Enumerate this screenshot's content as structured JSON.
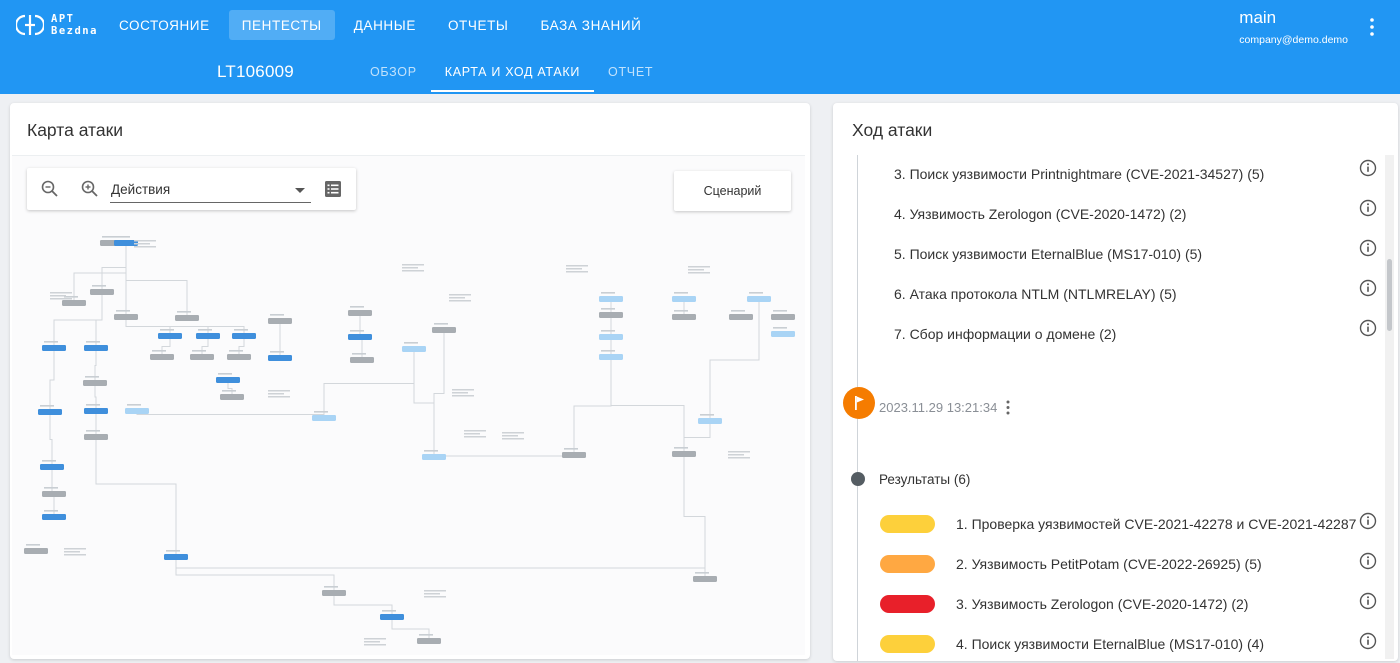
{
  "app": {
    "logo_lines": [
      "APT",
      "Bezdna"
    ],
    "nav": [
      "СОСТОЯНИЕ",
      "ПЕНТЕСТЫ",
      "ДАННЫЕ",
      "ОТЧЕТЫ",
      "БАЗА ЗНАНИЙ"
    ],
    "active_nav": "ПЕНТЕСТЫ",
    "user_name": "main",
    "user_email": "company@demo.demo"
  },
  "pentest": {
    "id": "LT106009",
    "tabs": [
      "ОБЗОР",
      "КАРТА И ХОД АТАКИ",
      "ОТЧЕТ"
    ],
    "active_tab": "КАРТА И ХОД АТАКИ"
  },
  "attack_map": {
    "title": "Карта атаки",
    "filter_value": "Действия",
    "scenario_label": "Сценарий",
    "icons": [
      "zoom-out-icon",
      "zoom-in-icon",
      "list-icon"
    ]
  },
  "attack_progress": {
    "title": "Ход атаки",
    "steps": [
      "3. Поиск уязвимости Printnightmare (CVE-2021-34527) (5)",
      "4. Уязвимость Zerologon (CVE-2020-1472) (2)",
      "5. Поиск уязвимости EternalBlue (MS17-010) (5)",
      "6. Атака протокола NTLM (NTLMRELAY) (5)",
      "7. Сбор информации о домене (2)"
    ],
    "timestamp": "2023.11.29 13:21:34",
    "results_label": "Результаты (6)",
    "results": [
      {
        "label": "1. Проверка уязвимостей CVE-2021-42278 и CVE-2021-42287",
        "color": "#fdd03b"
      },
      {
        "label": "2. Уязвимость PetitPotam (CVE-2022-26925) (5)",
        "color": "#ffa842"
      },
      {
        "label": "3. Уязвимость Zerologon (CVE-2020-1472) (2)",
        "color": "#e8202a"
      },
      {
        "label": "4. Поиск уязвимости EternalBlue (MS17-010) (4)",
        "color": "#fdd03b"
      }
    ]
  },
  "colors": {
    "primary": "#2196f3",
    "node_blue": "#3f8fdc",
    "node_light": "#a9d4f5",
    "node_gray": "#a8adb2",
    "flag": "#f57c00"
  }
}
